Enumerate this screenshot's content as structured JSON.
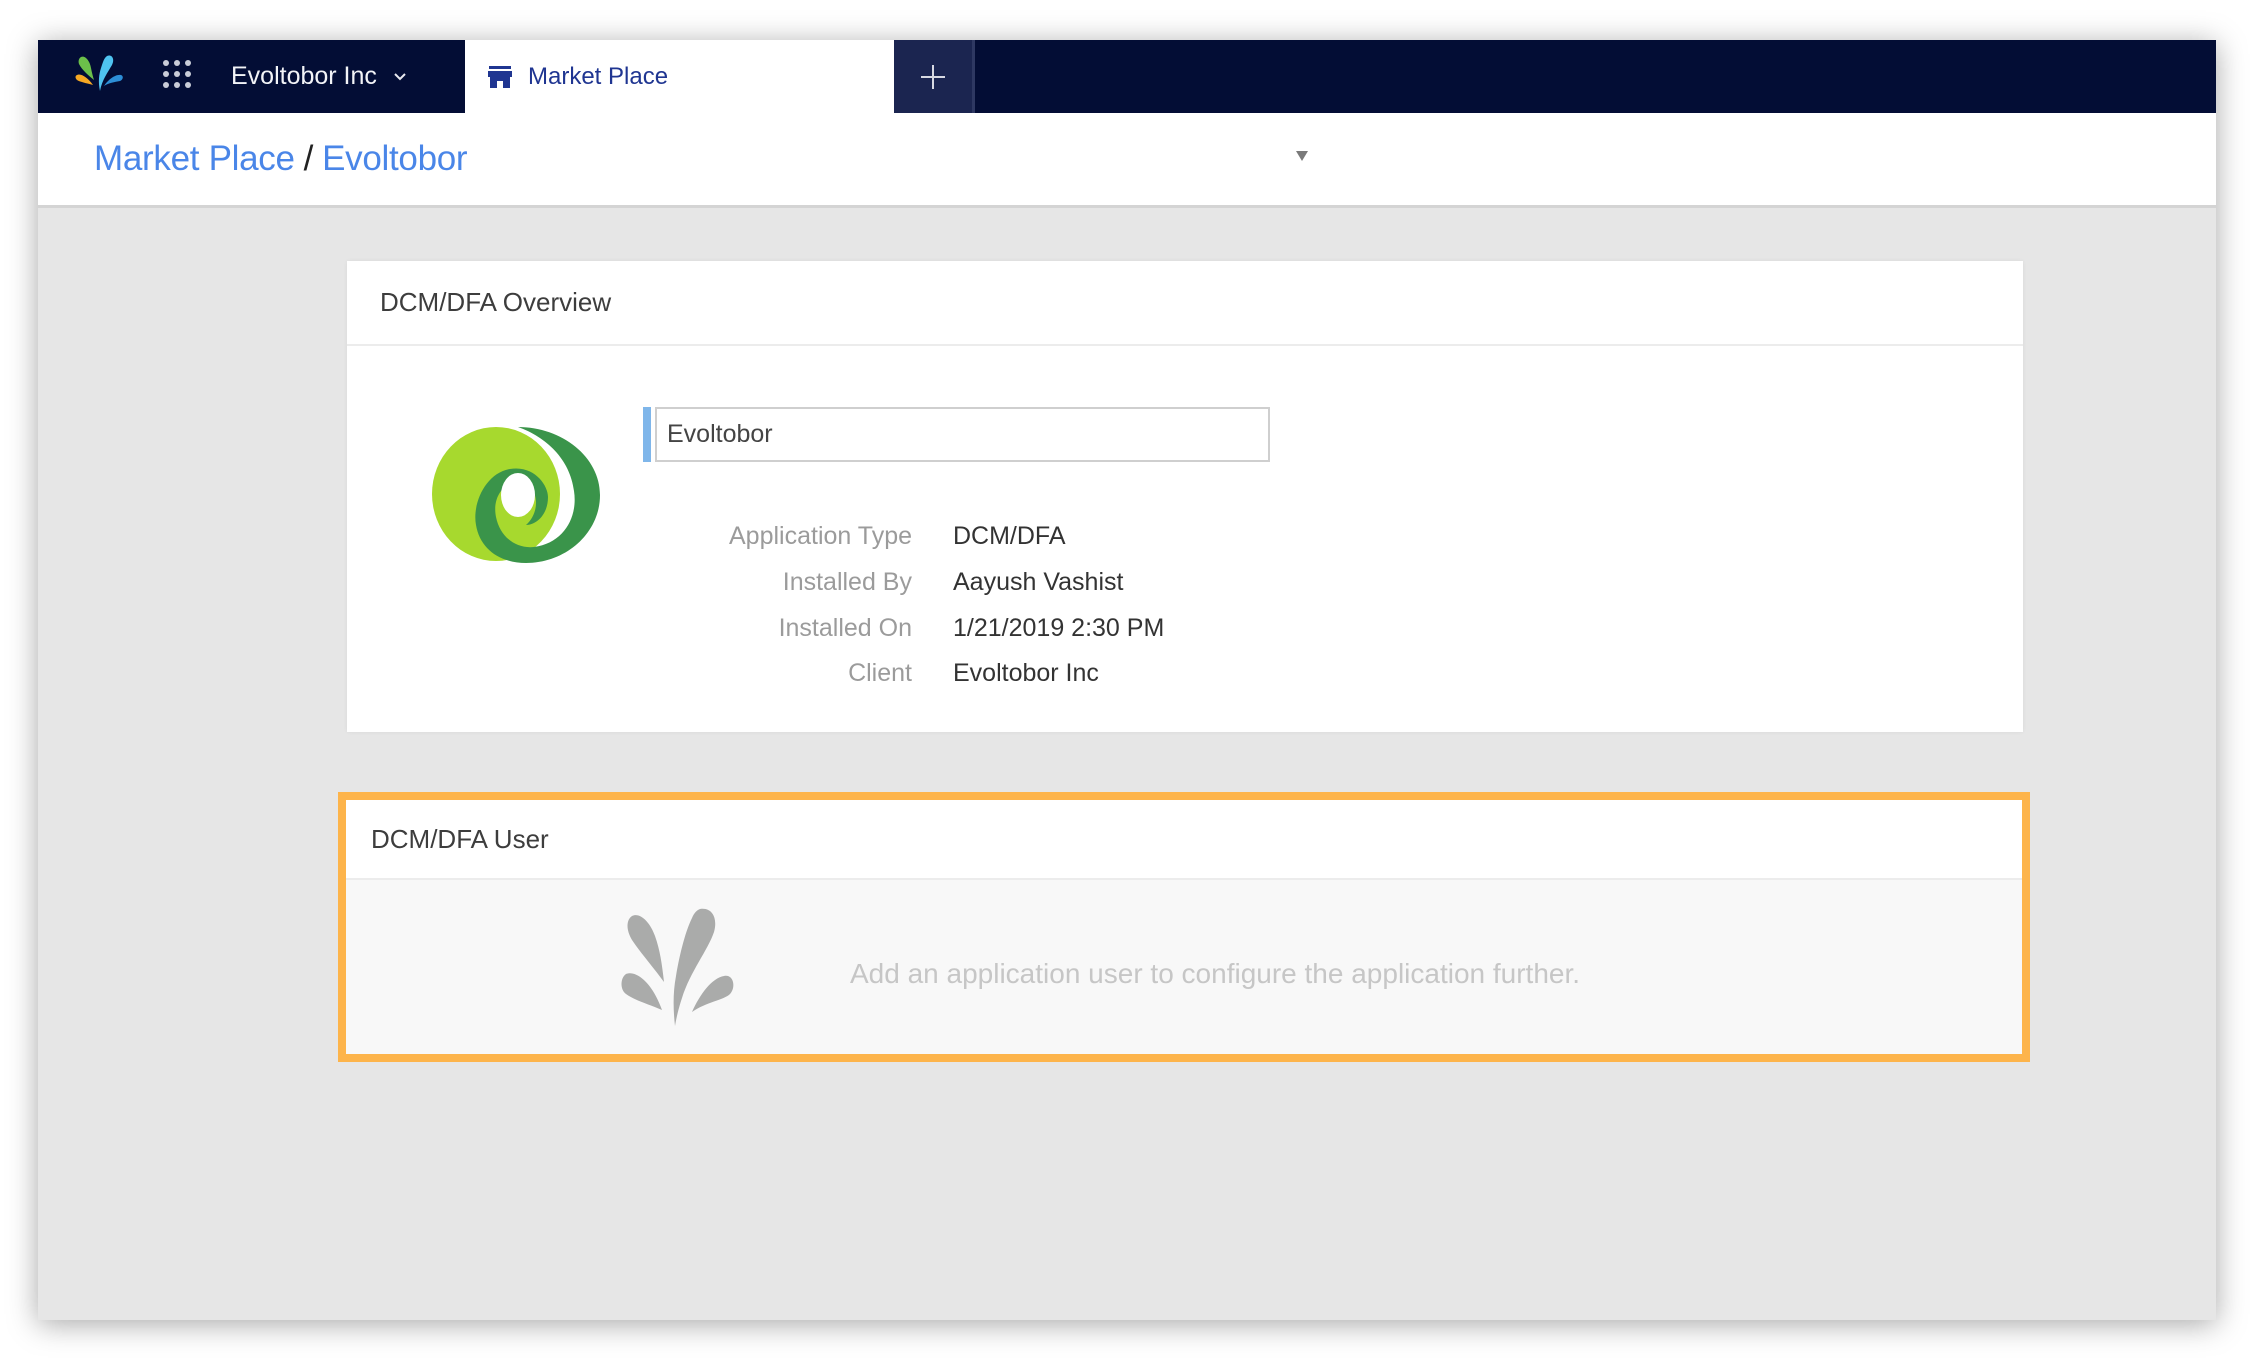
{
  "navbar": {
    "brand_logo": "evoltobor-splash-logo",
    "apps_icon": "grid-icon",
    "org_name": "Evoltobor Inc",
    "org_chevron": "chevron-down-icon",
    "active_tab": {
      "label": "Market Place",
      "icon": "store-icon"
    },
    "new_tab_icon": "plus-icon"
  },
  "breadcrumb": {
    "items": [
      "Market Place",
      "Evoltobor"
    ],
    "separator": "/",
    "dropdown_icon": "caret-down-icon"
  },
  "overview_card": {
    "title": "DCM/DFA Overview",
    "app_logo": "doubleclick-logo",
    "name_value": "Evoltobor",
    "details": [
      {
        "label": "Application Type",
        "value": "DCM/DFA"
      },
      {
        "label": "Installed By",
        "value": "Aayush Vashist"
      },
      {
        "label": "Installed On",
        "value": "1/21/2019 2:30 PM"
      },
      {
        "label": "Client",
        "value": "Evoltobor Inc"
      }
    ]
  },
  "user_card": {
    "title": "DCM/DFA User",
    "empty_icon": "splash-placeholder-icon",
    "empty_message": "Add an application user to configure the application further.",
    "highlight_color": "#fdb44b"
  },
  "colors": {
    "navbar_bg": "#030d35",
    "tab_text": "#1f3591",
    "link": "#4a86e8",
    "page_bg": "#e6e6e6"
  }
}
